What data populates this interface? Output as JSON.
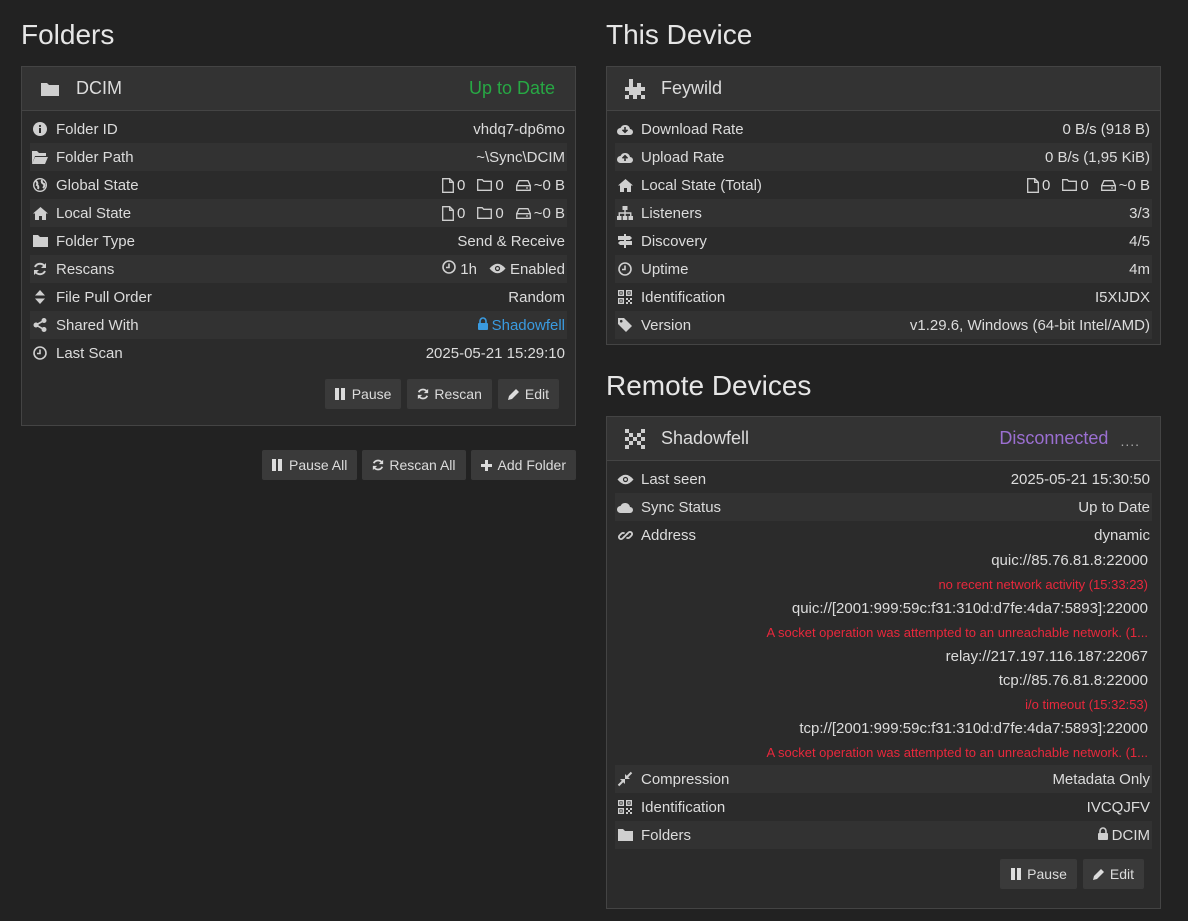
{
  "folders": {
    "heading": "Folders",
    "folder": {
      "name": "DCIM",
      "status": "Up to Date",
      "rows": {
        "folder_id": {
          "label": "Folder ID",
          "value": "vhdq7-dp6mo"
        },
        "folder_path": {
          "label": "Folder Path",
          "value": "~\\Sync\\DCIM"
        },
        "global_state": {
          "label": "Global State",
          "files": "0",
          "dirs": "0",
          "size": "~0 B"
        },
        "local_state": {
          "label": "Local State",
          "files": "0",
          "dirs": "0",
          "size": "~0 B"
        },
        "folder_type": {
          "label": "Folder Type",
          "value": "Send & Receive"
        },
        "rescans": {
          "label": "Rescans",
          "interval": "1h",
          "watch": "Enabled"
        },
        "pull_order": {
          "label": "File Pull Order",
          "value": "Random"
        },
        "shared_with": {
          "label": "Shared With",
          "value": "Shadowfell"
        },
        "last_scan": {
          "label": "Last Scan",
          "value": "2025-05-21 15:29:10"
        }
      },
      "buttons": {
        "pause": "Pause",
        "rescan": "Rescan",
        "edit": "Edit"
      }
    },
    "actions": {
      "pause_all": "Pause All",
      "rescan_all": "Rescan All",
      "add_folder": "Add Folder"
    }
  },
  "this_device": {
    "heading": "This Device",
    "name": "Feywild",
    "rows": {
      "download": {
        "label": "Download Rate",
        "value": "0 B/s (918 B)"
      },
      "upload": {
        "label": "Upload Rate",
        "value": "0 B/s (1,95 KiB)"
      },
      "local_state": {
        "label": "Local State (Total)",
        "files": "0",
        "dirs": "0",
        "size": "~0 B"
      },
      "listeners": {
        "label": "Listeners",
        "value": "3/3"
      },
      "discovery": {
        "label": "Discovery",
        "value": "4/5"
      },
      "uptime": {
        "label": "Uptime",
        "value": "4m"
      },
      "identification": {
        "label": "Identification",
        "value": "I5XIJDX"
      },
      "version": {
        "label": "Version",
        "value": "v1.29.6, Windows (64-bit Intel/AMD)"
      }
    }
  },
  "remote_devices": {
    "heading": "Remote Devices",
    "device": {
      "name": "Shadowfell",
      "status": "Disconnected",
      "more": "....",
      "rows": {
        "last_seen": {
          "label": "Last seen",
          "value": "2025-05-21 15:30:50"
        },
        "sync_status": {
          "label": "Sync Status",
          "value": "Up to Date"
        },
        "address": {
          "label": "Address",
          "value": "dynamic",
          "lines": [
            {
              "text": "quic://85.76.81.8:22000",
              "error": "no recent network activity (15:33:23)"
            },
            {
              "text": "quic://[2001:999:59c:f31:310d:d7fe:4da7:5893]:22000",
              "error": "A socket operation was attempted to an unreachable network. (1..."
            },
            {
              "text": "relay://217.197.116.187:22067"
            },
            {
              "text": "tcp://85.76.81.8:22000",
              "error": "i/o timeout (15:32:53)"
            },
            {
              "text": "tcp://[2001:999:59c:f31:310d:d7fe:4da7:5893]:22000",
              "error": "A socket operation was attempted to an unreachable network. (1..."
            }
          ]
        },
        "compression": {
          "label": "Compression",
          "value": "Metadata Only"
        },
        "identification": {
          "label": "Identification",
          "value": "IVCQJFV"
        },
        "folders": {
          "label": "Folders",
          "value": "DCIM"
        }
      },
      "buttons": {
        "pause": "Pause",
        "edit": "Edit"
      }
    }
  },
  "colors": {
    "ok": "#27a844",
    "link": "#3a9be0",
    "error": "#e8283c",
    "disconnected": "#9b6fd1",
    "background": "#222222",
    "panel": "#2b2b2b"
  },
  "icons": [
    "folder-icon",
    "info-icon",
    "folder-open-icon",
    "globe-icon",
    "home-icon",
    "refresh-icon",
    "clock-icon",
    "eye-icon",
    "sort-icon",
    "share-icon",
    "lock-icon",
    "file-icon",
    "hdd-icon",
    "pause-icon",
    "pencil-icon",
    "plus-icon",
    "cloud-download-icon",
    "cloud-upload-icon",
    "sitemap-icon",
    "signpost-icon",
    "qrcode-icon",
    "tag-icon",
    "cloud-icon",
    "link-icon",
    "compress-icon",
    "device-identicon"
  ]
}
